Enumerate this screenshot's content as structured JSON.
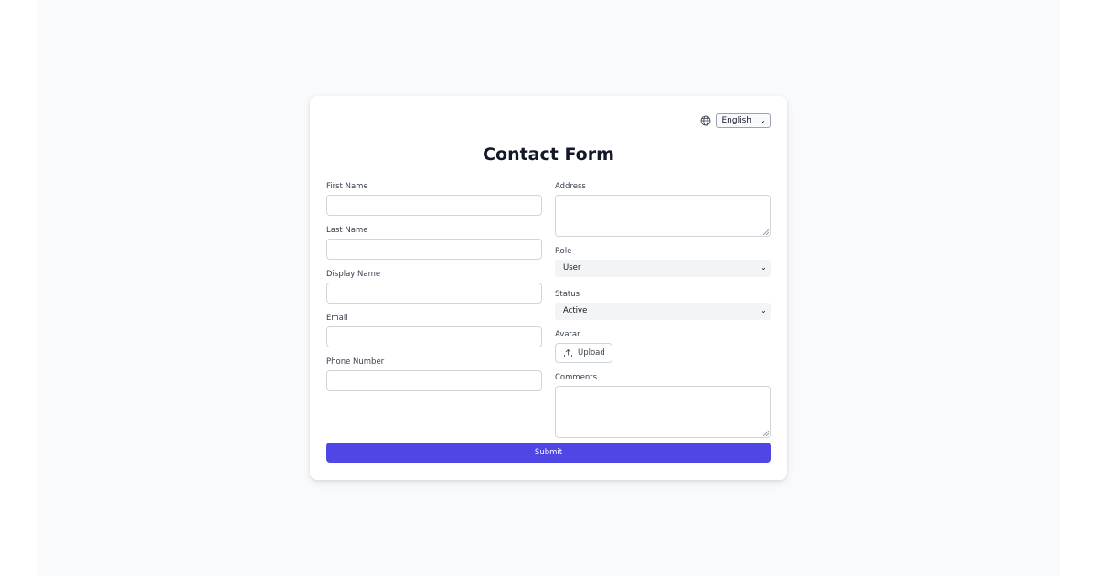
{
  "form": {
    "title": "Contact Form",
    "language": {
      "selected": "English"
    },
    "left_fields": [
      {
        "label": "First Name",
        "value": ""
      },
      {
        "label": "Last Name",
        "value": ""
      },
      {
        "label": "Display Name",
        "value": ""
      },
      {
        "label": "Email",
        "value": ""
      },
      {
        "label": "Phone Number",
        "value": ""
      }
    ],
    "address": {
      "label": "Address",
      "value": ""
    },
    "role": {
      "label": "Role",
      "selected": "User"
    },
    "status": {
      "label": "Status",
      "selected": "Active"
    },
    "avatar": {
      "label": "Avatar",
      "button_label": "Upload"
    },
    "comments": {
      "label": "Comments",
      "value": ""
    },
    "submit_label": "Submit"
  },
  "icons": {
    "language": "globe-icon",
    "upload": "upload-icon",
    "dropdown": "chevron-down-icon"
  },
  "colors": {
    "accent": "#4f46e5",
    "page_background": "#f9fafb",
    "card_background": "#ffffff"
  }
}
